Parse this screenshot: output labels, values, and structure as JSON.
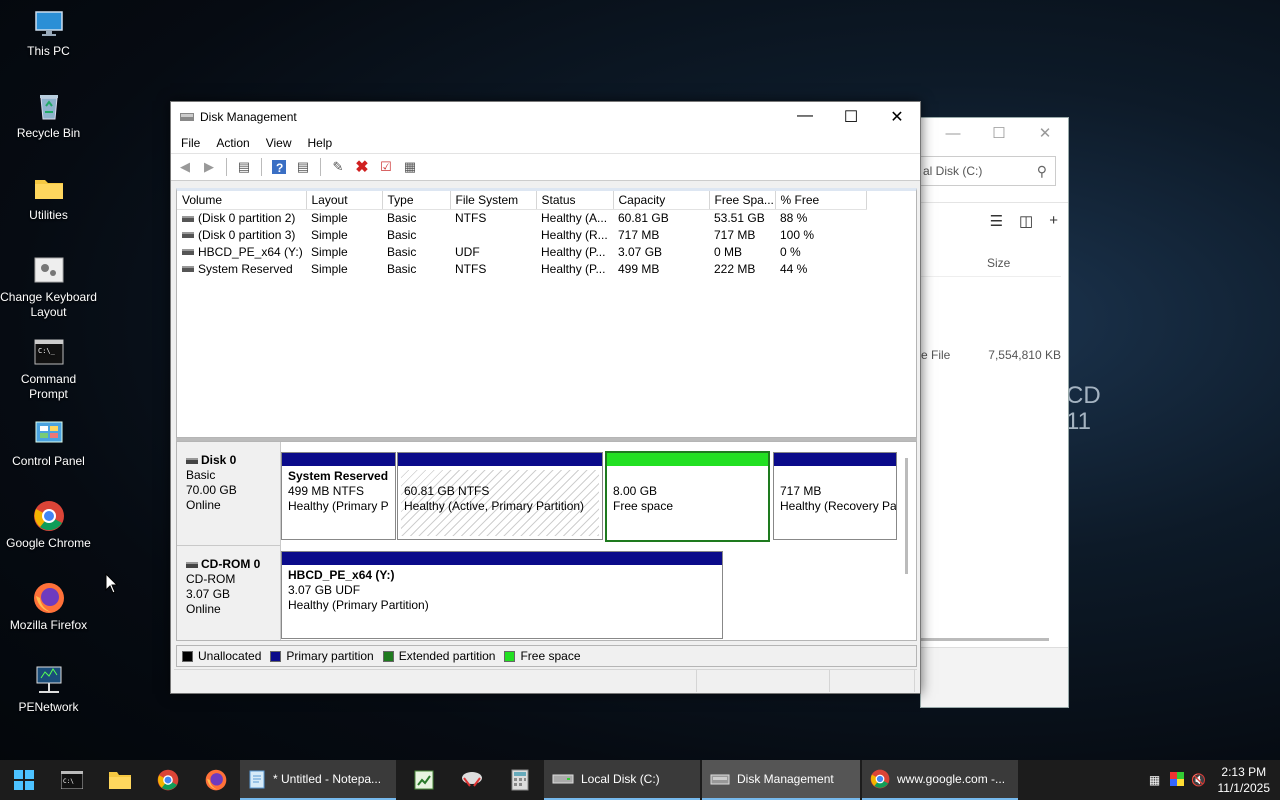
{
  "desktop": {
    "icons": [
      {
        "label": "This PC",
        "icon": "this-pc-icon"
      },
      {
        "label": "Recycle Bin",
        "icon": "recycle-bin-icon"
      },
      {
        "label": "Utilities",
        "icon": "folder-icon"
      },
      {
        "label": "Change Keyboard Layout",
        "icon": "keyboard-layout-icon"
      },
      {
        "label": "Command Prompt",
        "icon": "command-prompt-icon"
      },
      {
        "label": "Control Panel",
        "icon": "control-panel-icon"
      },
      {
        "label": "Google Chrome",
        "icon": "chrome-icon"
      },
      {
        "label": "Mozilla Firefox",
        "icon": "firefox-icon"
      },
      {
        "label": "PENetwork",
        "icon": "network-icon"
      }
    ],
    "wallpaper_text": [
      "CD",
      "11"
    ]
  },
  "explorer": {
    "address": "al Disk (C:)",
    "column_size": "Size",
    "row_type": "e File",
    "row_size": "7,554,810 KB"
  },
  "window": {
    "title": "Disk Management",
    "menu": [
      "File",
      "Action",
      "View",
      "Help"
    ]
  },
  "volumes": {
    "columns": [
      "Volume",
      "Layout",
      "Type",
      "File System",
      "Status",
      "Capacity",
      "Free Spa...",
      "% Free"
    ],
    "rows": [
      [
        "(Disk 0 partition 2)",
        "Simple",
        "Basic",
        "NTFS",
        "Healthy (A...",
        "60.81 GB",
        "53.51 GB",
        "88 %"
      ],
      [
        "(Disk 0 partition 3)",
        "Simple",
        "Basic",
        "",
        "Healthy (R...",
        "717 MB",
        "717 MB",
        "100 %"
      ],
      [
        "HBCD_PE_x64 (Y:)",
        "Simple",
        "Basic",
        "UDF",
        "Healthy (P...",
        "3.07 GB",
        "0 MB",
        "0 %"
      ],
      [
        "System Reserved",
        "Simple",
        "Basic",
        "NTFS",
        "Healthy (P...",
        "499 MB",
        "222 MB",
        "44 %"
      ]
    ]
  },
  "disks": {
    "disk0": {
      "name": "Disk 0",
      "type": "Basic",
      "size": "70.00 GB",
      "state": "Online",
      "partitions": [
        {
          "title": "System Reserved",
          "line1": "499 MB NTFS",
          "line2": "Healthy (Primary P"
        },
        {
          "title": "",
          "line1": "60.81 GB NTFS",
          "line2": "Healthy (Active, Primary Partition)"
        },
        {
          "title": "",
          "line1": "8.00 GB",
          "line2": "Free space"
        },
        {
          "title": "",
          "line1": "717 MB",
          "line2": "Healthy (Recovery Pa"
        }
      ]
    },
    "cdrom0": {
      "name": "CD-ROM 0",
      "type": "CD-ROM",
      "size": "3.07 GB",
      "state": "Online",
      "partition": {
        "title": "HBCD_PE_x64  (Y:)",
        "line1": "3.07 GB UDF",
        "line2": "Healthy (Primary Partition)"
      }
    }
  },
  "legend": [
    {
      "label": "Unallocated",
      "color": "#000000"
    },
    {
      "label": "Primary partition",
      "color": "#0b0b8a"
    },
    {
      "label": "Extended partition",
      "color": "#1e7a1e"
    },
    {
      "label": "Free space",
      "color": "#22e022"
    }
  ],
  "taskbar": {
    "tasks": [
      {
        "label": "* Untitled - Notepa...",
        "icon": "notepad-icon"
      },
      {
        "label": "Local Disk (C:)",
        "icon": "drive-icon"
      },
      {
        "label": "Disk Management",
        "icon": "disk-management-icon"
      },
      {
        "label": "www.google.com -...",
        "icon": "chrome-icon"
      }
    ],
    "time": "2:13 PM",
    "date": "11/1/2025"
  }
}
